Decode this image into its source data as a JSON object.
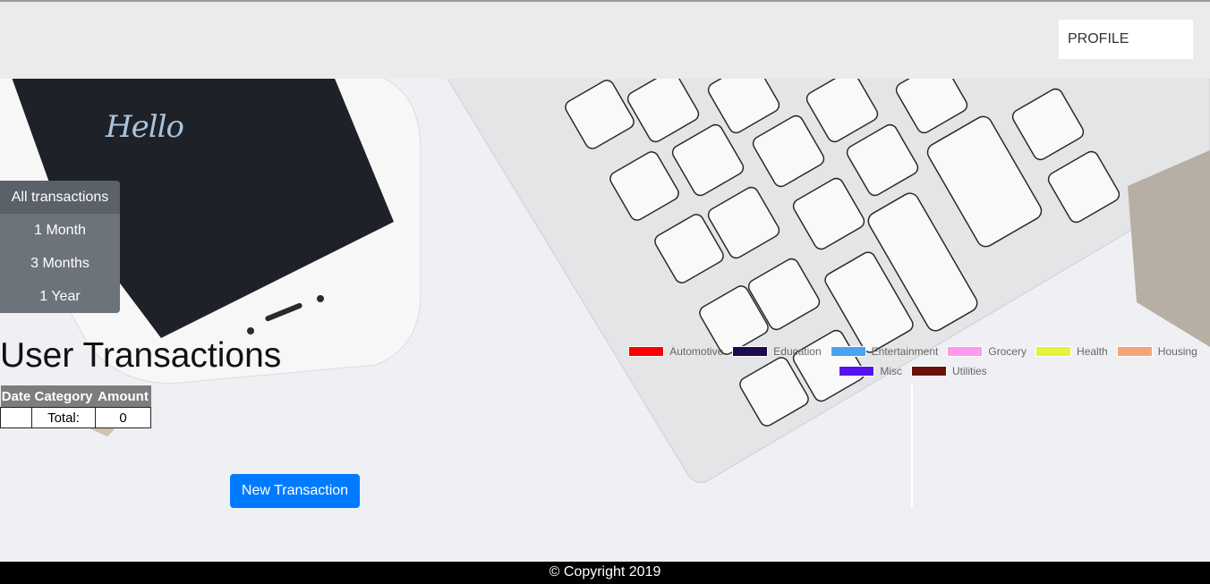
{
  "navbar": {
    "profile_label": "PROFILE"
  },
  "hero": {
    "greeting": "Hello"
  },
  "filters": [
    {
      "label": "All transactions",
      "active": true
    },
    {
      "label": "1 Month",
      "active": false
    },
    {
      "label": "3 Months",
      "active": false
    },
    {
      "label": "1 Year",
      "active": false
    }
  ],
  "transactions": {
    "title": "User Transactions",
    "columns": [
      "Date",
      "Category",
      "Amount"
    ],
    "total_label": "Total:",
    "total_value": "0"
  },
  "new_transaction_label": "New Transaction",
  "legend": [
    {
      "label": "Automotive",
      "color": "#ff0000"
    },
    {
      "label": "Education",
      "color": "#1b0a4f"
    },
    {
      "label": "Entertainment",
      "color": "#4aa3f0"
    },
    {
      "label": "Grocery",
      "color": "#ff99ee"
    },
    {
      "label": "Health",
      "color": "#e6f23a"
    },
    {
      "label": "Housing",
      "color": "#f5a47a"
    },
    {
      "label": "Misc",
      "color": "#5511ee"
    },
    {
      "label": "Utilities",
      "color": "#6b1208"
    }
  ],
  "footer": {
    "copyright": "© Copyright 2019"
  }
}
